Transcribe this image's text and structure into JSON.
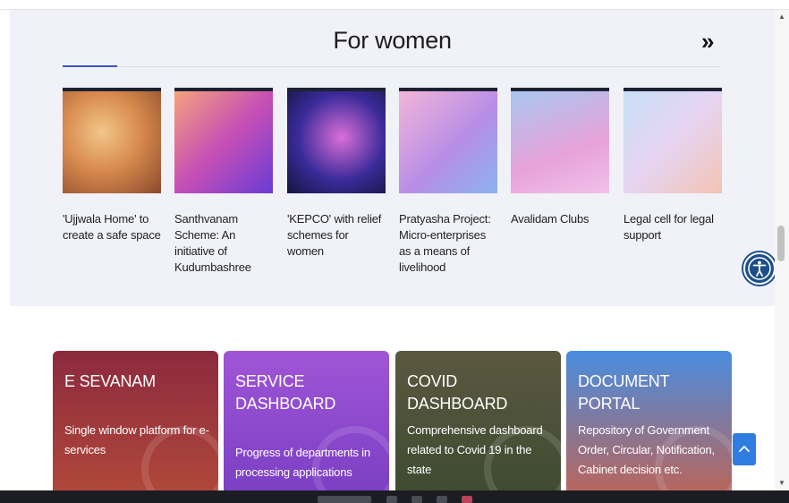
{
  "section": {
    "title": "For women",
    "next_icon": "double-chevron-right-icon",
    "cards": [
      {
        "caption": "'Ujjwala Home' to create a safe space"
      },
      {
        "caption": "Santhvanam Scheme: An initiative of Kudumbashree"
      },
      {
        "caption": "'KEPCO' with relief schemes for women"
      },
      {
        "caption": "Pratyasha Project: Micro-enterprises as a means of livelihood"
      },
      {
        "caption": "Avalidam Clubs"
      },
      {
        "caption": "Legal cell for legal support"
      }
    ]
  },
  "tiles": [
    {
      "title": "E SEVANAM",
      "desc": "Single window platform for e-services",
      "color": "#8e2c3f"
    },
    {
      "title": "SERVICE DASHBOARD",
      "desc": "Progress of departments in processing applications",
      "color": "#8f4bc9"
    },
    {
      "title": "COVID DASHBOARD",
      "desc": "Comprehensive dashboard related to Covid 19 in the state",
      "color": "#4f4a35"
    },
    {
      "title": "DOCUMENT PORTAL",
      "desc": "Repository of Government Order, Circular, Notification, Cabinet decision etc.",
      "color": "#3d7fdc"
    }
  ],
  "icons": {
    "accessibility": "accessibility-icon",
    "scroll_top": "chevron-up-icon"
  }
}
